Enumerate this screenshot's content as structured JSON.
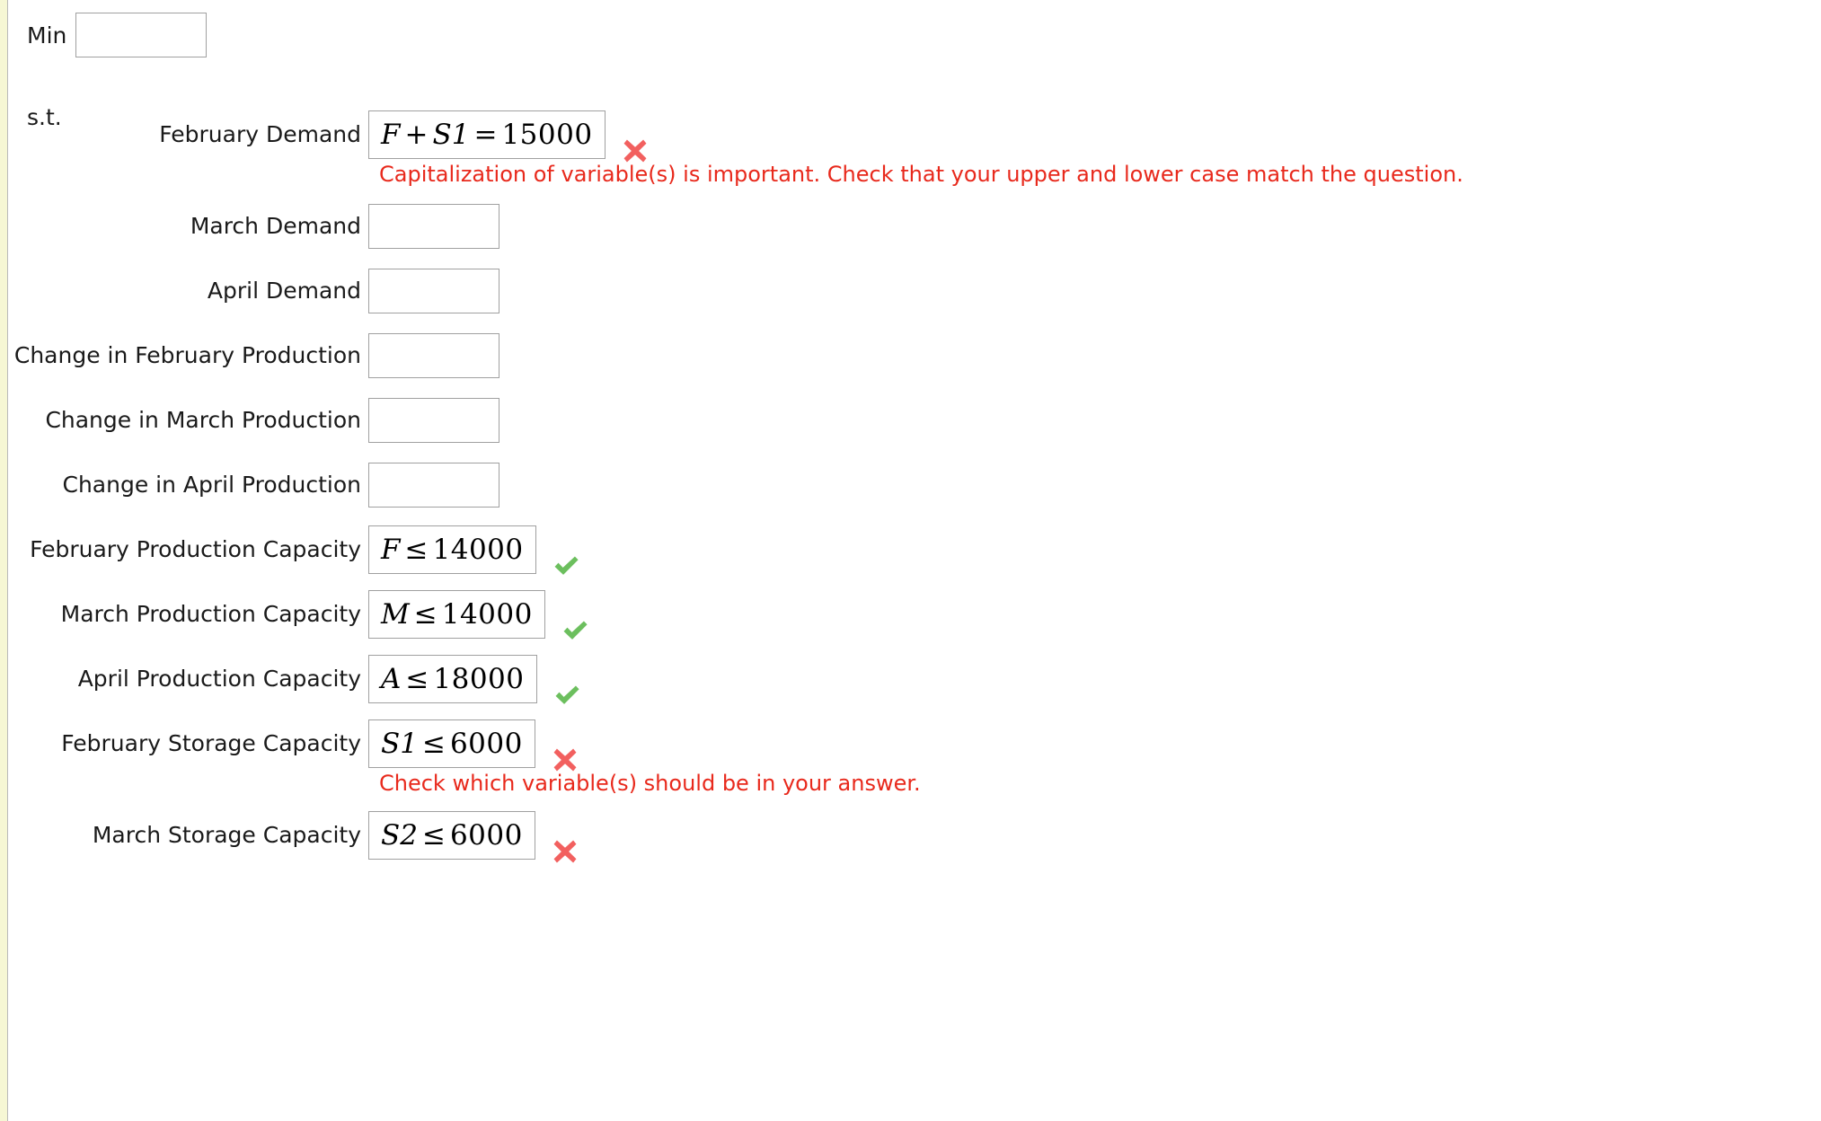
{
  "objective": {
    "label": "Min",
    "value": "",
    "placeholder": ""
  },
  "subject_to_label": "s.t.",
  "constraints": [
    {
      "label": "February Demand",
      "type": "math",
      "expression": "F + S1 = 15000",
      "parts": [
        {
          "kind": "var",
          "text": "F"
        },
        {
          "kind": "op",
          "text": "+"
        },
        {
          "kind": "var",
          "text": "S1"
        },
        {
          "kind": "op",
          "text": "="
        },
        {
          "kind": "num",
          "text": "15000"
        }
      ],
      "status": "incorrect",
      "feedback": "Capitalization of variable(s) is important. Check that your upper and lower case match the question."
    },
    {
      "label": "March Demand",
      "type": "input",
      "value": "",
      "status": "none",
      "feedback": ""
    },
    {
      "label": "April Demand",
      "type": "input",
      "value": "",
      "status": "none",
      "feedback": ""
    },
    {
      "label": "Change in February Production",
      "type": "input",
      "value": "",
      "status": "none",
      "feedback": ""
    },
    {
      "label": "Change in March Production",
      "type": "input",
      "value": "",
      "status": "none",
      "feedback": ""
    },
    {
      "label": "Change in April Production",
      "type": "input",
      "value": "",
      "status": "none",
      "feedback": ""
    },
    {
      "label": "February Production Capacity",
      "type": "math",
      "expression": "F ≤ 14000",
      "parts": [
        {
          "kind": "var",
          "text": "F"
        },
        {
          "kind": "op",
          "text": "≤"
        },
        {
          "kind": "num",
          "text": "14000"
        }
      ],
      "status": "correct",
      "feedback": ""
    },
    {
      "label": "March Production Capacity",
      "type": "math",
      "expression": "M ≤ 14000",
      "parts": [
        {
          "kind": "var",
          "text": "M"
        },
        {
          "kind": "op",
          "text": "≤"
        },
        {
          "kind": "num",
          "text": "14000"
        }
      ],
      "status": "correct",
      "feedback": ""
    },
    {
      "label": "April Production Capacity",
      "type": "math",
      "expression": "A ≤ 18000",
      "parts": [
        {
          "kind": "var",
          "text": "A"
        },
        {
          "kind": "op",
          "text": "≤"
        },
        {
          "kind": "num",
          "text": "18000"
        }
      ],
      "status": "correct",
      "feedback": ""
    },
    {
      "label": "February Storage Capacity",
      "type": "math",
      "expression": "S1 ≤ 6000",
      "parts": [
        {
          "kind": "var",
          "text": "S1"
        },
        {
          "kind": "op",
          "text": "≤"
        },
        {
          "kind": "num",
          "text": "6000"
        }
      ],
      "status": "incorrect",
      "feedback": "Check which variable(s) should be in your answer."
    },
    {
      "label": "March Storage Capacity",
      "type": "math",
      "expression": "S2 ≤ 6000",
      "parts": [
        {
          "kind": "var",
          "text": "S2"
        },
        {
          "kind": "op",
          "text": "≤"
        },
        {
          "kind": "num",
          "text": "6000"
        }
      ],
      "status": "incorrect",
      "feedback": ""
    }
  ],
  "colors": {
    "correct": "#6cbf5e",
    "incorrect_mark": "#f2605f",
    "feedback_text": "#e8291c",
    "input_border": "#a0a0a0",
    "gutter": "#f6f7d4"
  },
  "icons": {
    "correct": "check-icon",
    "incorrect": "cross-icon"
  }
}
